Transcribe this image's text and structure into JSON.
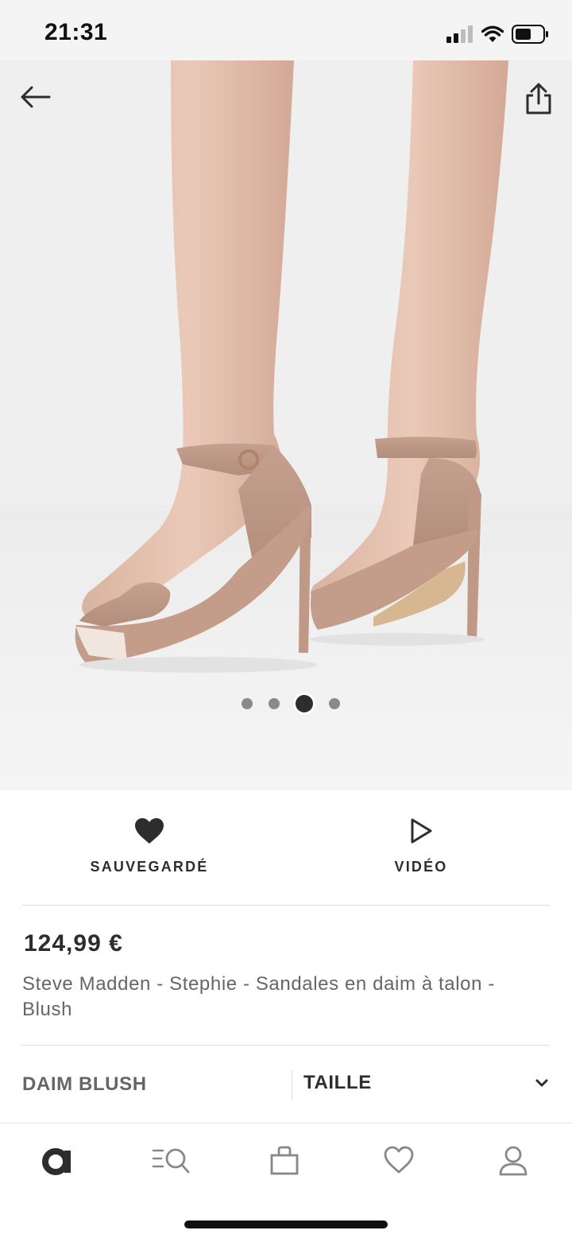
{
  "status": {
    "time": "21:31"
  },
  "hero": {
    "image_count": 4,
    "active_index": 2
  },
  "actions": {
    "save_label": "SAUVEGARDÉ",
    "video_label": "VIDÉO",
    "saved": true
  },
  "product": {
    "price": "124,99 €",
    "name": "Steve Madden - Stephie - Sandales en daim à talon - Blush"
  },
  "selectors": {
    "color": "DAIM BLUSH",
    "size_label": "TAILLE"
  },
  "tab_bar": {
    "items": [
      {
        "icon": "asos-logo-icon",
        "active": true
      },
      {
        "icon": "search-icon"
      },
      {
        "icon": "bag-icon"
      },
      {
        "icon": "heart-icon"
      },
      {
        "icon": "account-icon"
      }
    ]
  },
  "colors": {
    "accent": "#2d2d2d",
    "muted": "#666666",
    "divider": "#dddddd",
    "background": "#ffffff"
  }
}
